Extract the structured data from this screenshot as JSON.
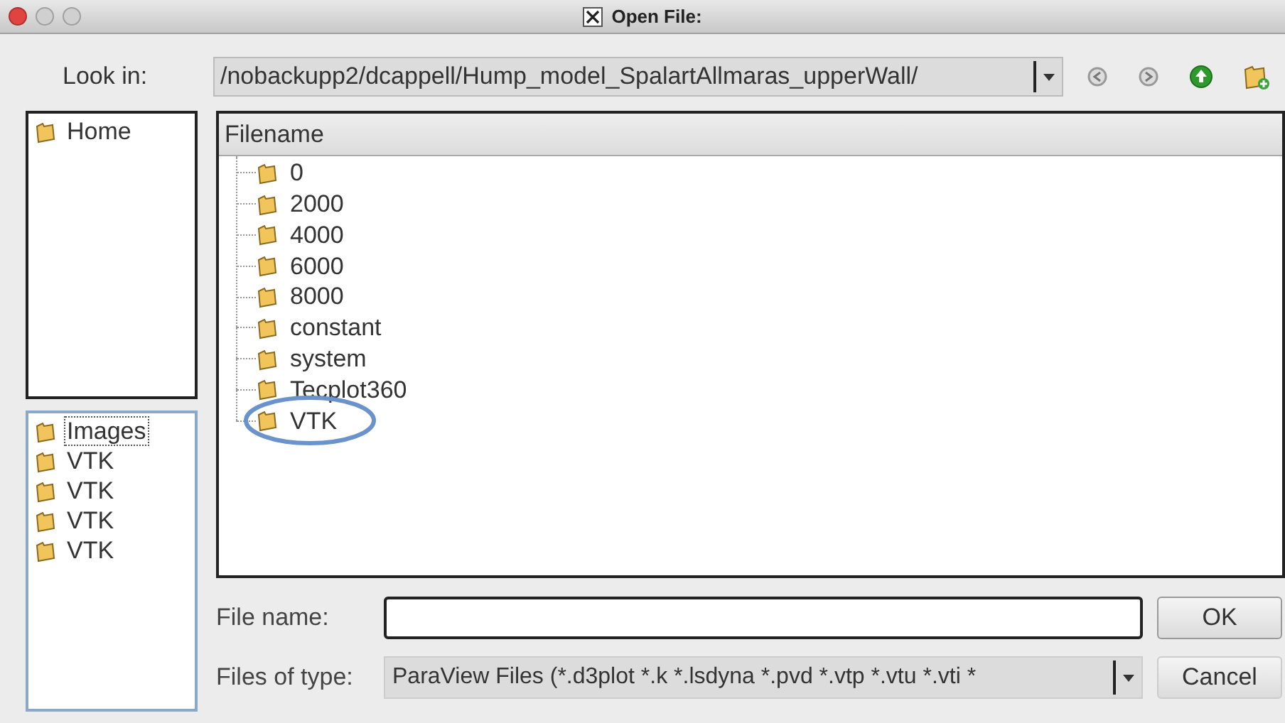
{
  "window": {
    "title": "Open File:"
  },
  "look_in": {
    "label": "Look in:",
    "path": "/nobackupp2/dcappell/Hump_model_SpalartAllmaras_upperWall/"
  },
  "places": [
    {
      "label": "Home"
    }
  ],
  "recent": [
    {
      "label": "Images",
      "selected": true
    },
    {
      "label": "VTK",
      "selected": false
    },
    {
      "label": "VTK",
      "selected": false
    },
    {
      "label": "VTK",
      "selected": false
    },
    {
      "label": "VTK",
      "selected": false
    }
  ],
  "file_list": {
    "header": "Filename",
    "items": [
      {
        "label": "0",
        "highlighted": false
      },
      {
        "label": "2000",
        "highlighted": false
      },
      {
        "label": "4000",
        "highlighted": false
      },
      {
        "label": "6000",
        "highlighted": false
      },
      {
        "label": "8000",
        "highlighted": false
      },
      {
        "label": "constant",
        "highlighted": false
      },
      {
        "label": "system",
        "highlighted": false
      },
      {
        "label": "Tecplot360",
        "highlighted": false
      },
      {
        "label": "VTK",
        "highlighted": true
      }
    ]
  },
  "file_name": {
    "label": "File name:"
  },
  "file_type": {
    "label": "Files of type:",
    "value": "ParaView Files (*.d3plot *.k *.lsdyna *.pvd *.vtp *.vtu *.vti *"
  },
  "buttons": [
    {
      "label": "OK"
    },
    {
      "label": "Cancel"
    }
  ]
}
